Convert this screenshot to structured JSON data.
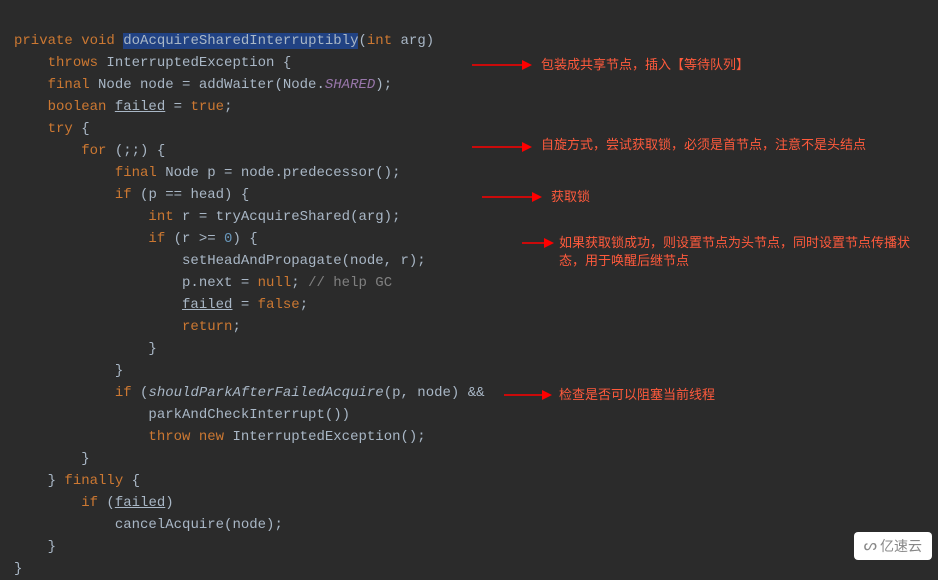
{
  "code": {
    "l1_kw1": "private",
    "l1_kw2": "void",
    "l1_method": "doAcquireSharedInterruptibly",
    "l1_paren_open": "(",
    "l1_kw3": "int",
    "l1_arg": " arg)",
    "l2_throws": "throws",
    "l2_exc": " InterruptedException {",
    "l3_final": "final",
    "l3_node": " Node node = addWaiter(Node.",
    "l3_shared": "SHARED",
    "l3_end": ");",
    "l4_bool": "boolean",
    "l4_failed": "failed",
    "l4_eq": " = ",
    "l4_true": "true",
    "l4_semi": ";",
    "l5_try": "try",
    "l5_brace": " {",
    "l6_for": "for",
    "l6_rest": " (;;) {",
    "l7_final": "final",
    "l7_rest": " Node p = node.predecessor();",
    "l8_if": "if",
    "l8_rest": " (p == head) {",
    "l9_int": "int",
    "l9_rest": " r = tryAcquireShared(arg);",
    "l10_if": "if",
    "l10_rest": " (r >= ",
    "l10_zero": "0",
    "l10_end": ") {",
    "l11": "setHeadAndPropagate(node, r);",
    "l12_a": "p.next = ",
    "l12_null": "null",
    "l12_semi": "; ",
    "l12_comment": "// help GC",
    "l13_failed": "failed",
    "l13_eq": " = ",
    "l13_false": "false",
    "l13_semi": ";",
    "l14_return": "return",
    "l14_semi": ";",
    "l15": "}",
    "l16": "}",
    "l17_if": "if",
    "l17_open": " (",
    "l17_call": "shouldParkAfterFailedAcquire",
    "l17_args": "(p, node) &&",
    "l18": "parkAndCheckInterrupt())",
    "l19_throw": "throw",
    "l19_new": "new",
    "l19_rest": " InterruptedException();",
    "l20": "}",
    "l21_close": "} ",
    "l21_finally": "finally",
    "l21_brace": " {",
    "l22_if": "if",
    "l22_open": " (",
    "l22_failed": "failed",
    "l22_close": ")",
    "l23": "cancelAcquire(node);",
    "l24": "}",
    "l25": "}"
  },
  "annotations": {
    "a1": "包装成共享节点，插入【等待队列】",
    "a2": "自旋方式，尝试获取锁，必须是首节点，注意不是头结点",
    "a3": "获取锁",
    "a4": "如果获取锁成功，则设置节点为头节点，同时设置节点传播状态，用于唤醒后继节点",
    "a5": "检查是否可以阻塞当前线程"
  },
  "watermark": {
    "logo": "ᔕ",
    "text": "亿速云"
  }
}
